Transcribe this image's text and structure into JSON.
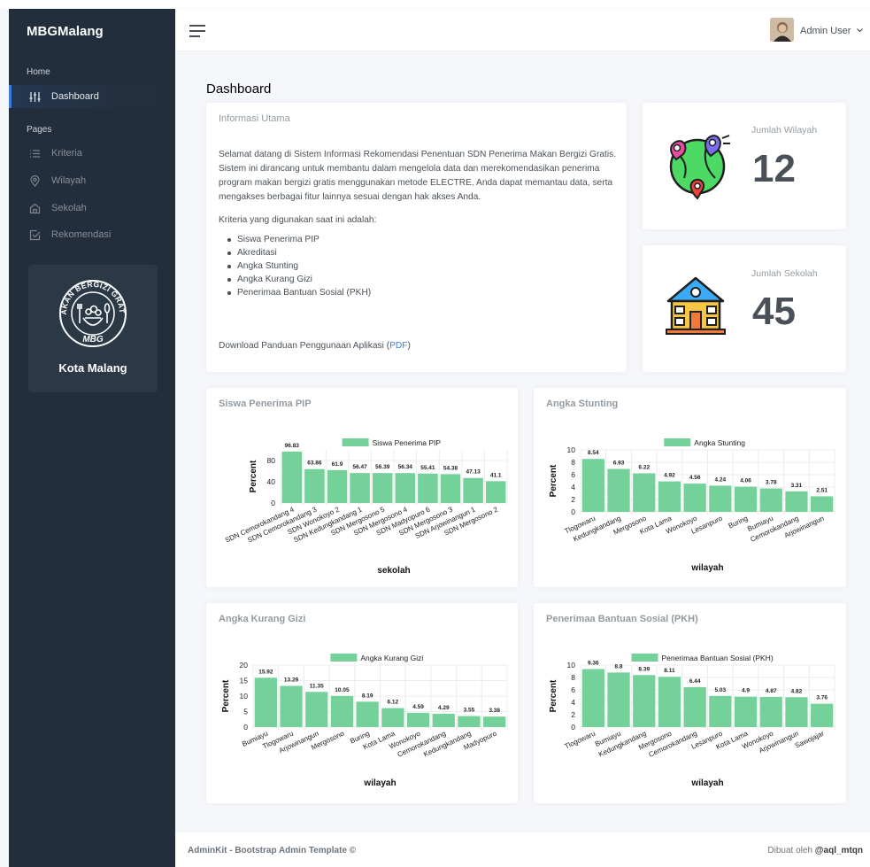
{
  "app": {
    "brand": "MBGMalang"
  },
  "sidebar": {
    "headers": {
      "home": "Home",
      "pages": "Pages"
    },
    "items": [
      {
        "label": "Dashboard",
        "icon": "sliders-icon",
        "active": true
      },
      {
        "label": "Kriteria",
        "icon": "list-icon"
      },
      {
        "label": "Wilayah",
        "icon": "map-pin-icon"
      },
      {
        "label": "Sekolah",
        "icon": "home-icon"
      },
      {
        "label": "Rekomendasi",
        "icon": "check-square-icon"
      }
    ],
    "logo": {
      "ring_text": "MAKAN BERGIZI GRATIS",
      "mbg": "MBG"
    },
    "city": "Kota Malang"
  },
  "navbar": {
    "user": "Admin User"
  },
  "page": {
    "title": "Dashboard"
  },
  "info": {
    "title": "Informasi Utama",
    "paragraph": "Selamat datang di Sistem Informasi Rekomendasi Penentuan SDN Penerima Makan Bergizi Gratis. Sistem ini dirancang untuk membantu dalam mengelola data dan merekomendasikan penerima program makan bergizi gratis menggunakan metode ELECTRE. Anda dapat memantau data, serta mengakses berbagai fitur lainnya sesuai dengan hak akses Anda.",
    "criteria_intro": "Kriteria yang digunakan saat ini adalah:",
    "criteria": [
      "Siswa Penerima PIP",
      "Akreditasi",
      "Angka Stunting",
      "Angka Kurang Gizi",
      "Penerimaa Bantuan Sosial (PKH)"
    ],
    "download_prefix": "Download Panduan Penggunaan Aplikasi (",
    "download_link": "PDF",
    "download_suffix": ")"
  },
  "stats": {
    "wilayah": {
      "label": "Jumlah Wilayah",
      "value": "12"
    },
    "sekolah": {
      "label": "Jumlah Sekolah",
      "value": "45"
    }
  },
  "footer": {
    "left": "AdminKit - Bootstrap Admin Template ©",
    "right_prefix": "Dibuat oleh ",
    "right_author": "@aql_mtqn"
  },
  "chart_data": [
    {
      "id": "pip",
      "card_title": "Siswa Penerima PIP",
      "type": "bar",
      "legend": "Siswa Penerima PIP",
      "categories": [
        "SDN Cemorokandang 4",
        "SDN Cemorokandang 3",
        "SDN Wonokoyo 2",
        "SDN Kedungkandang 1",
        "SDN Mergosono 5",
        "SDN Mergosono 4",
        "SDN Madyopuro 6",
        "SDN Mergosono 3",
        "SDN Arjowinangun 1",
        "SDN Mergosono 2"
      ],
      "values": [
        96.83,
        63.86,
        61.9,
        56.47,
        56.39,
        56.34,
        55.41,
        54.38,
        47.13,
        41.1
      ],
      "labels": [
        "96.83",
        "63.86",
        "61.9",
        "56.47",
        "56.39",
        "56.34",
        "55.41",
        "54.38",
        "47.13",
        "41.1"
      ],
      "yticks": [
        "0",
        "40",
        "80"
      ],
      "ylim": [
        0,
        100
      ],
      "xlabel": "sekolah",
      "ylabel": "Percent",
      "color": "#74d19a"
    },
    {
      "id": "stunting",
      "card_title": "Angka Stunting",
      "type": "bar",
      "legend": "Angka Stunting",
      "categories": [
        "Tlogowaru",
        "Kedungkandang",
        "Mergosono",
        "Kota Lama",
        "Wonokoyo",
        "Lesanpuro",
        "Buring",
        "Bumiayu",
        "Cemorokandang",
        "Arjowinangun"
      ],
      "values": [
        8.54,
        6.93,
        6.22,
        4.92,
        4.56,
        4.24,
        4.06,
        3.78,
        3.31,
        2.51
      ],
      "labels": [
        "8.54",
        "6.93",
        "6.22",
        "4.92",
        "4.56",
        "4.24",
        "4.06",
        "3.78",
        "3.31",
        "2.51"
      ],
      "yticks": [
        "0",
        "2",
        "4",
        "6",
        "8",
        "10"
      ],
      "ylim": [
        0,
        10
      ],
      "xlabel": "wilayah",
      "ylabel": "Percent",
      "color": "#74d19a"
    },
    {
      "id": "gizi",
      "card_title": "Angka Kurang Gizi",
      "type": "bar",
      "legend": "Angka Kurang Gizi",
      "categories": [
        "Bumiayu",
        "Tlogowaru",
        "Arjowinangun",
        "Mergosono",
        "Buring",
        "Kota Lama",
        "Wonokoyo",
        "Cemorokandang",
        "Kedungkandang",
        "Madyopuro"
      ],
      "values": [
        15.92,
        13.29,
        11.35,
        10.05,
        8.19,
        6.12,
        4.59,
        4.29,
        3.55,
        3.38
      ],
      "labels": [
        "15.92",
        "13.29",
        "11.35",
        "10.05",
        "8.19",
        "6.12",
        "4.59",
        "4.29",
        "3.55",
        "3.38"
      ],
      "yticks": [
        "0",
        "5",
        "10",
        "15",
        "20"
      ],
      "ylim": [
        0,
        20
      ],
      "xlabel": "wilayah",
      "ylabel": "Percent",
      "color": "#74d19a"
    },
    {
      "id": "pkh",
      "card_title": "Penerimaa Bantuan Sosial (PKH)",
      "type": "bar",
      "legend": "Penerimaa Bantuan Sosial (PKH)",
      "categories": [
        "Tlogowaru",
        "Bumiayu",
        "Kedungkandang",
        "Mergosono",
        "Cemorokandang",
        "Lesanpuro",
        "Kota Lama",
        "Wonokoyo",
        "Arjowinangun",
        "Sawojajar"
      ],
      "values": [
        9.36,
        8.8,
        8.39,
        8.11,
        6.44,
        5.03,
        4.9,
        4.87,
        4.82,
        3.76
      ],
      "labels": [
        "9.36",
        "8.8",
        "8.39",
        "8.11",
        "6.44",
        "5.03",
        "4.9",
        "4.87",
        "4.82",
        "3.76"
      ],
      "yticks": [
        "0",
        "2",
        "4",
        "6",
        "8",
        "10"
      ],
      "ylim": [
        0,
        10
      ],
      "xlabel": "wilayah",
      "ylabel": "Percent",
      "color": "#74d19a"
    }
  ]
}
